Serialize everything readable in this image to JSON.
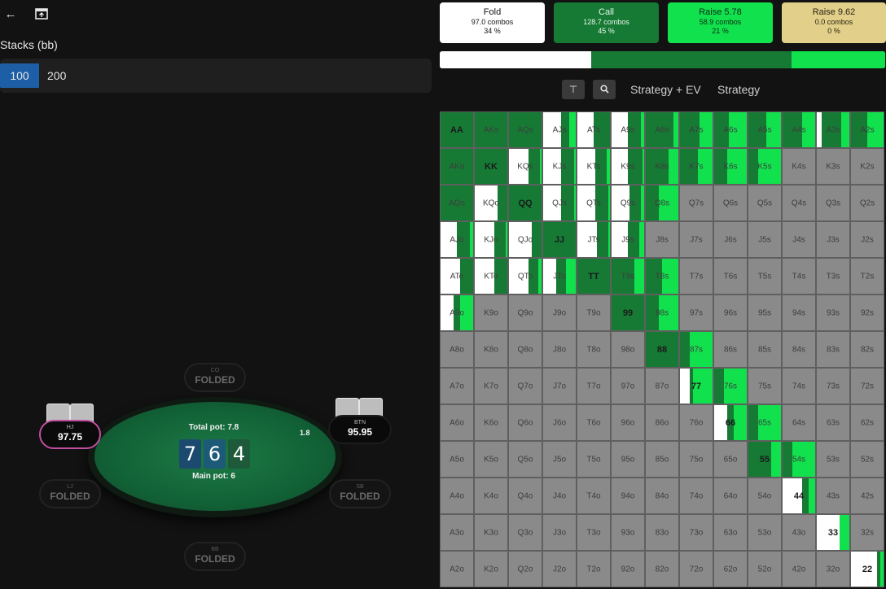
{
  "toolbar": {
    "back_icon": "arrow-left-icon",
    "view_icon": "window-icon"
  },
  "stacks": {
    "label": "Stacks (bb)",
    "options": [
      "100",
      "200"
    ],
    "selected": "100"
  },
  "table": {
    "total_pot": "Total pot: 7.8",
    "main_pot": "Main pot: 6",
    "pot_digits": [
      "7",
      "6",
      "4"
    ],
    "side_value": "1.8",
    "seats": [
      {
        "pos": "CO",
        "value": "FOLDED",
        "state": "folded"
      },
      {
        "pos": "HJ",
        "value": "97.75",
        "state": "active"
      },
      {
        "pos": "BTN",
        "value": "95.95",
        "state": "active"
      },
      {
        "pos": "LJ",
        "value": "FOLDED",
        "state": "folded"
      },
      {
        "pos": "SB",
        "value": "FOLDED",
        "state": "folded"
      },
      {
        "pos": "BB",
        "value": "FOLDED",
        "state": "folded"
      }
    ]
  },
  "actions": [
    {
      "name": "Fold",
      "combos": "97.0 combos",
      "pct": "34 %",
      "color": "#ffffff"
    },
    {
      "name": "Call",
      "combos": "128.7 combos",
      "pct": "45 %",
      "color": "#167a34"
    },
    {
      "name": "Raise 5.78",
      "combos": "58.9 combos",
      "pct": "21 %",
      "color": "#12e14e"
    },
    {
      "name": "Raise 9.62",
      "combos": "0.0 combos",
      "pct": "0 %",
      "color": "#e1cf8a"
    }
  ],
  "freq": {
    "fold": 0.34,
    "call": 0.45,
    "raise": 0.21
  },
  "view_tabs": [
    "Strategy + EV",
    "Strategy"
  ],
  "matrix": {
    "ranks": [
      "A",
      "K",
      "Q",
      "J",
      "T",
      "9",
      "8",
      "7",
      "6",
      "5",
      "4",
      "3",
      "2"
    ],
    "colors": {
      "fold": "#ffffff",
      "call": "#167a34",
      "raise": "#12e14e",
      "none": "#8a8a8a"
    },
    "active": [
      [
        "r",
        [
          0,
          100,
          0
        ]
      ],
      [
        "r",
        [
          0,
          100,
          0
        ]
      ],
      [
        "r",
        [
          0,
          100,
          0
        ]
      ],
      [
        "r",
        [
          55,
          25,
          20
        ]
      ],
      [
        "r",
        [
          50,
          50,
          0
        ]
      ],
      [
        "r",
        [
          50,
          40,
          10
        ]
      ],
      [
        "r",
        [
          0,
          85,
          15
        ]
      ],
      [
        "r",
        [
          0,
          60,
          40
        ]
      ],
      [
        "r",
        [
          0,
          45,
          55
        ]
      ],
      [
        "r",
        [
          0,
          55,
          45
        ]
      ],
      [
        "r",
        [
          0,
          60,
          40
        ]
      ],
      [
        "r",
        [
          15,
          60,
          25
        ]
      ],
      [
        "r",
        [
          0,
          50,
          50
        ]
      ],
      [
        "r",
        [
          0,
          100,
          0
        ]
      ],
      [
        "r",
        [
          0,
          100,
          0
        ]
      ],
      [
        "r",
        [
          60,
          35,
          5
        ]
      ],
      [
        "r",
        [
          55,
          40,
          5
        ]
      ],
      [
        "r",
        [
          55,
          35,
          10
        ]
      ],
      [
        "r",
        [
          50,
          45,
          5
        ]
      ],
      [
        "r",
        [
          0,
          70,
          30
        ]
      ],
      [
        "r",
        [
          0,
          55,
          45
        ]
      ],
      [
        "r",
        [
          0,
          40,
          60
        ]
      ],
      [
        "r",
        [
          0,
          30,
          70
        ]
      ],
      [
        "n"
      ],
      [
        "n"
      ],
      [
        "n"
      ],
      [
        "r",
        [
          0,
          100,
          0
        ]
      ],
      [
        "r",
        [
          70,
          30,
          0
        ]
      ],
      [
        "r",
        [
          0,
          100,
          0
        ]
      ],
      [
        "r",
        [
          55,
          40,
          5
        ]
      ],
      [
        "r",
        [
          55,
          40,
          5
        ]
      ],
      [
        "r",
        [
          55,
          35,
          10
        ]
      ],
      [
        "r",
        [
          0,
          40,
          60
        ]
      ],
      [
        "n"
      ],
      [
        "n"
      ],
      [
        "n"
      ],
      [
        "n"
      ],
      [
        "n"
      ],
      [
        "n"
      ],
      [
        "r",
        [
          50,
          40,
          10
        ]
      ],
      [
        "r",
        [
          60,
          35,
          5
        ]
      ],
      [
        "r",
        [
          70,
          30,
          0
        ]
      ],
      [
        "r",
        [
          0,
          100,
          0
        ]
      ],
      [
        "r",
        [
          60,
          35,
          5
        ]
      ],
      [
        "r",
        [
          50,
          35,
          15
        ]
      ],
      [
        "n"
      ],
      [
        "n"
      ],
      [
        "n"
      ],
      [
        "n"
      ],
      [
        "n"
      ],
      [
        "n"
      ],
      [
        "n"
      ],
      [
        "r",
        [
          60,
          40,
          0
        ]
      ],
      [
        "r",
        [
          60,
          40,
          0
        ]
      ],
      [
        "r",
        [
          60,
          30,
          10
        ]
      ],
      [
        "r",
        [
          40,
          30,
          30
        ]
      ],
      [
        "r",
        [
          0,
          100,
          0
        ]
      ],
      [
        "r",
        [
          0,
          70,
          30
        ]
      ],
      [
        "r",
        [
          0,
          50,
          50
        ]
      ],
      [
        "n"
      ],
      [
        "n"
      ],
      [
        "n"
      ],
      [
        "n"
      ],
      [
        "n"
      ],
      [
        "n"
      ],
      [
        "r",
        [
          40,
          20,
          40
        ]
      ],
      [
        "n"
      ],
      [
        "n"
      ],
      [
        "n"
      ],
      [
        "n"
      ],
      [
        "r",
        [
          0,
          100,
          0
        ]
      ],
      [
        "r",
        [
          0,
          40,
          60
        ]
      ],
      [
        "n"
      ],
      [
        "n"
      ],
      [
        "n"
      ],
      [
        "n"
      ],
      [
        "n"
      ],
      [
        "n"
      ],
      [
        "n"
      ],
      [
        "n"
      ],
      [
        "n"
      ],
      [
        "n"
      ],
      [
        "n"
      ],
      [
        "n"
      ],
      [
        "r",
        [
          0,
          100,
          0
        ]
      ],
      [
        "r",
        [
          0,
          30,
          70
        ]
      ],
      [
        "n"
      ],
      [
        "n"
      ],
      [
        "n"
      ],
      [
        "n"
      ],
      [
        "n"
      ],
      [
        "n"
      ],
      [
        "n"
      ],
      [
        "n"
      ],
      [
        "n"
      ],
      [
        "n"
      ],
      [
        "n"
      ],
      [
        "n"
      ],
      [
        "r",
        [
          30,
          10,
          60
        ]
      ],
      [
        "r",
        [
          0,
          30,
          70
        ]
      ],
      [
        "n"
      ],
      [
        "n"
      ],
      [
        "n"
      ],
      [
        "n"
      ],
      [
        "n"
      ],
      [
        "n"
      ],
      [
        "n"
      ],
      [
        "n"
      ],
      [
        "n"
      ],
      [
        "n"
      ],
      [
        "n"
      ],
      [
        "n"
      ],
      [
        "r",
        [
          40,
          20,
          40
        ]
      ],
      [
        "r",
        [
          0,
          30,
          70
        ]
      ],
      [
        "n"
      ],
      [
        "n"
      ],
      [
        "n"
      ],
      [
        "n"
      ],
      [
        "n"
      ],
      [
        "n"
      ],
      [
        "n"
      ],
      [
        "n"
      ],
      [
        "n"
      ],
      [
        "n"
      ],
      [
        "n"
      ],
      [
        "n"
      ],
      [
        "r",
        [
          0,
          70,
          30
        ]
      ],
      [
        "r",
        [
          0,
          30,
          70
        ]
      ],
      [
        "n"
      ],
      [
        "n"
      ],
      [
        "n"
      ],
      [
        "n"
      ],
      [
        "n"
      ],
      [
        "n"
      ],
      [
        "n"
      ],
      [
        "n"
      ],
      [
        "n"
      ],
      [
        "n"
      ],
      [
        "n"
      ],
      [
        "n"
      ],
      [
        "r",
        [
          60,
          20,
          20
        ]
      ],
      [
        "n"
      ],
      [
        "n"
      ],
      [
        "n"
      ],
      [
        "n"
      ],
      [
        "n"
      ],
      [
        "n"
      ],
      [
        "n"
      ],
      [
        "n"
      ],
      [
        "n"
      ],
      [
        "n"
      ],
      [
        "n"
      ],
      [
        "n"
      ],
      [
        "n"
      ],
      [
        "r",
        [
          70,
          0,
          30
        ]
      ],
      [
        "n"
      ],
      [
        "n"
      ],
      [
        "n"
      ],
      [
        "n"
      ],
      [
        "n"
      ],
      [
        "n"
      ],
      [
        "n"
      ],
      [
        "n"
      ],
      [
        "n"
      ],
      [
        "n"
      ],
      [
        "n"
      ],
      [
        "n"
      ],
      [
        "n"
      ],
      [
        "r",
        [
          80,
          10,
          10
        ]
      ]
    ]
  }
}
